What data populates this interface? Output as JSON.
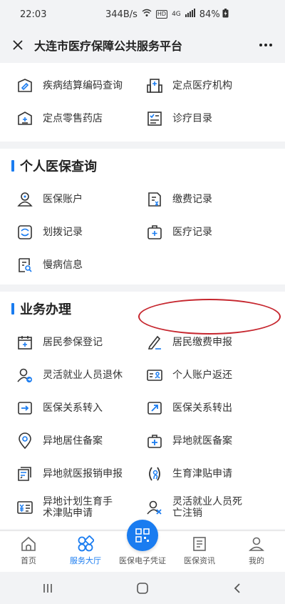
{
  "status_bar": {
    "time": "22:03",
    "speed": "344B/s",
    "network": "4G",
    "hd": "HD",
    "battery": "84%"
  },
  "title_bar": {
    "title": "大连市医疗保障公共服务平台"
  },
  "top_section": {
    "items": [
      {
        "label": "疾病结算编码查询",
        "icon": "tag-box-icon"
      },
      {
        "label": "定点医疗机构",
        "icon": "hospital-icon"
      },
      {
        "label": "定点零售药店",
        "icon": "pharmacy-icon"
      },
      {
        "label": "诊疗目录",
        "icon": "checklist-icon"
      }
    ]
  },
  "personal_section": {
    "title": "个人医保查询",
    "items": [
      {
        "label": "医保账户",
        "icon": "user-icon"
      },
      {
        "label": "缴费记录",
        "icon": "payment-doc-icon"
      },
      {
        "label": "划拨记录",
        "icon": "transfer-icon"
      },
      {
        "label": "医疗记录",
        "icon": "medical-kit-icon"
      },
      {
        "label": "慢病信息",
        "icon": "search-doc-icon"
      }
    ]
  },
  "business_section": {
    "title": "业务办理",
    "items": [
      {
        "label": "居民参保登记",
        "icon": "calendar-plus-icon"
      },
      {
        "label": "居民缴费申报",
        "icon": "pen-icon"
      },
      {
        "label": "灵活就业人员退休",
        "icon": "user-retire-icon"
      },
      {
        "label": "个人账户返还",
        "icon": "id-card-icon"
      },
      {
        "label": "医保关系转入",
        "icon": "arrow-in-icon"
      },
      {
        "label": "医保关系转出",
        "icon": "arrow-out-icon"
      },
      {
        "label": "异地居住备案",
        "icon": "location-icon"
      },
      {
        "label": "异地就医备案",
        "icon": "medical-bag-icon"
      },
      {
        "label": "异地就医报销申报",
        "icon": "claim-doc-icon"
      },
      {
        "label": "生育津贴申请",
        "icon": "maternity-icon"
      },
      {
        "label": "异地计划生育手术津贴申请",
        "icon": "money-doc-icon"
      },
      {
        "label": "灵活就业人员死亡注销",
        "icon": "user-cancel-icon"
      }
    ]
  },
  "tab_bar": {
    "tabs": [
      {
        "label": "首页",
        "icon": "home-icon"
      },
      {
        "label": "服务大厅",
        "icon": "services-icon",
        "active": true
      },
      {
        "label": "医保电子凭证",
        "icon": "qr-code-icon"
      },
      {
        "label": "医保资讯",
        "icon": "news-icon"
      },
      {
        "label": "我的",
        "icon": "profile-icon"
      }
    ]
  },
  "colors": {
    "accent": "#1a7cf0",
    "highlight_ring": "#c6262e"
  }
}
